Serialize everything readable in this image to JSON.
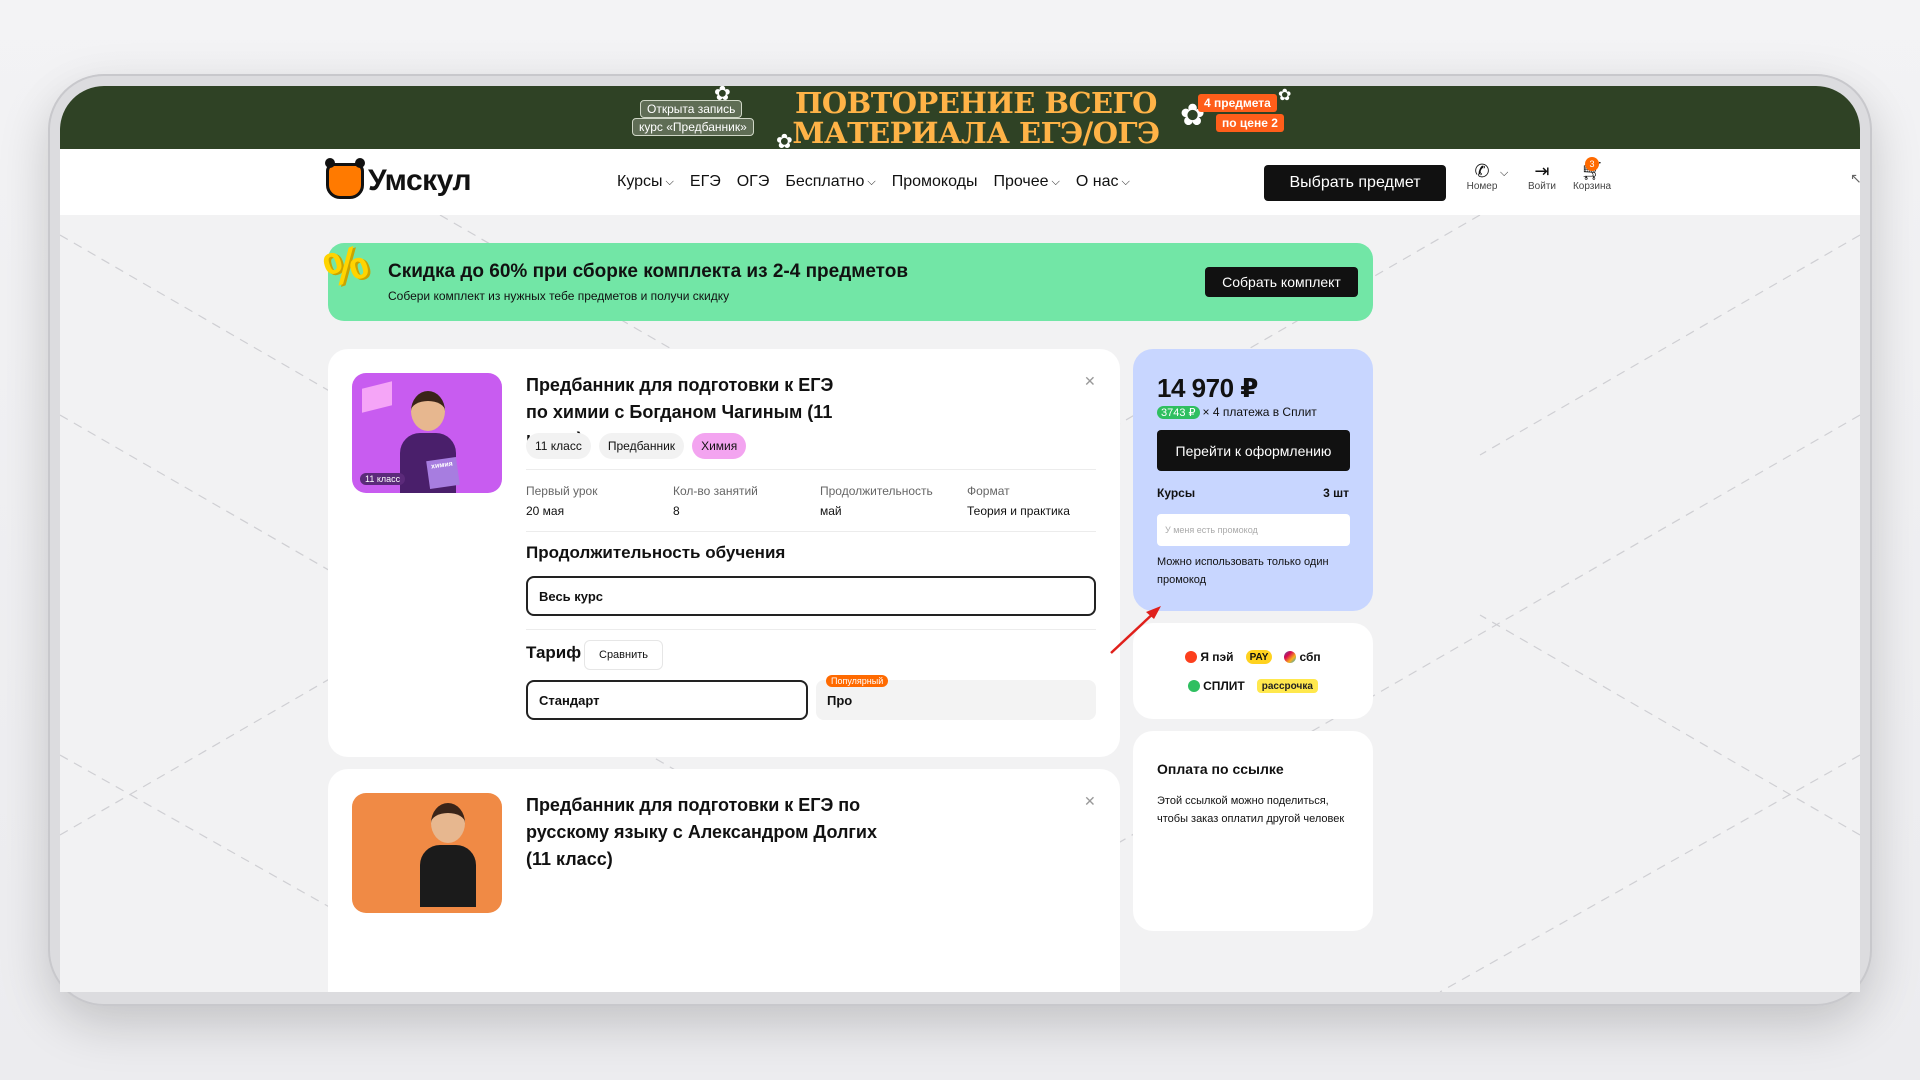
{
  "top_banner": {
    "left_pill_1": "Открыта запись",
    "left_pill_2": "курс «Предбанник»",
    "title": "ПОВТОРЕНИЕ ВСЕГО МАТЕРИАЛА ЕГЭ/ОГЭ",
    "right_badge_1": "4 предмета",
    "right_badge_2": "по цене 2"
  },
  "header": {
    "logo_text": "Умскул",
    "nav": [
      {
        "label": "Курсы",
        "dropdown": true
      },
      {
        "label": "ЕГЭ",
        "dropdown": false
      },
      {
        "label": "ОГЭ",
        "dropdown": false
      },
      {
        "label": "Бесплатно",
        "dropdown": true
      },
      {
        "label": "Промокоды",
        "dropdown": false
      },
      {
        "label": "Прочее",
        "dropdown": true
      },
      {
        "label": "О нас",
        "dropdown": true
      }
    ],
    "choose_button": "Выбрать предмет",
    "phone_label": "Номер",
    "login_label": "Войти",
    "cart_label": "Корзина",
    "cart_count": "3"
  },
  "promo_banner": {
    "headline": "Скидка до 60% при сборке комплекта из 2-4 предметов",
    "subline": "Собери комплект из нужных тебе предметов и получи скидку",
    "button": "Собрать комплект",
    "accent_color": "#72e6a6"
  },
  "course_1": {
    "title": "Предбанник для подготовки к ЕГЭ по химии с Богданом Чагиным (11 класс)",
    "thumb_tag": "11 класс",
    "thumb_book": "химия",
    "chips": [
      "11 класс",
      "Предбанник",
      "Химия"
    ],
    "meta": [
      {
        "key": "Первый урок",
        "value": "20 мая"
      },
      {
        "key": "Кол-во занятий",
        "value": "8"
      },
      {
        "key": "Продолжительность",
        "value": "май"
      },
      {
        "key": "Формат",
        "value": "Теория и практика"
      }
    ],
    "duration_heading": "Продолжительность обучения",
    "duration_value": "Весь курс",
    "tariff_heading": "Тариф",
    "compare_button": "Сравнить",
    "tariff_selected": "Стандарт",
    "tariff_other": "Про",
    "popular_badge": "Популярный"
  },
  "course_2": {
    "title": "Предбанник для подготовки к ЕГЭ по русскому языку с Александром Долгих (11 класс)"
  },
  "summary": {
    "price": "14 970 ₽",
    "split_amount": "3743 ₽",
    "split_text": "× 4 платежа в Сплит",
    "checkout_button": "Перейти к оформлению",
    "courses_label": "Курсы",
    "courses_count": "3 шт",
    "promo_placeholder": "У меня есть промокод",
    "promo_note": "Можно использовать только один промокод",
    "bg_color": "#c8d6ff"
  },
  "payments": {
    "row1": [
      "Я пэй",
      "PAY",
      "сбп"
    ],
    "row2": [
      "СПЛИТ",
      "рассрочка"
    ]
  },
  "pay_link": {
    "heading": "Оплата по ссылке",
    "description": "Этой ссылкой можно поделиться, чтобы заказ оплатил другой человек"
  }
}
